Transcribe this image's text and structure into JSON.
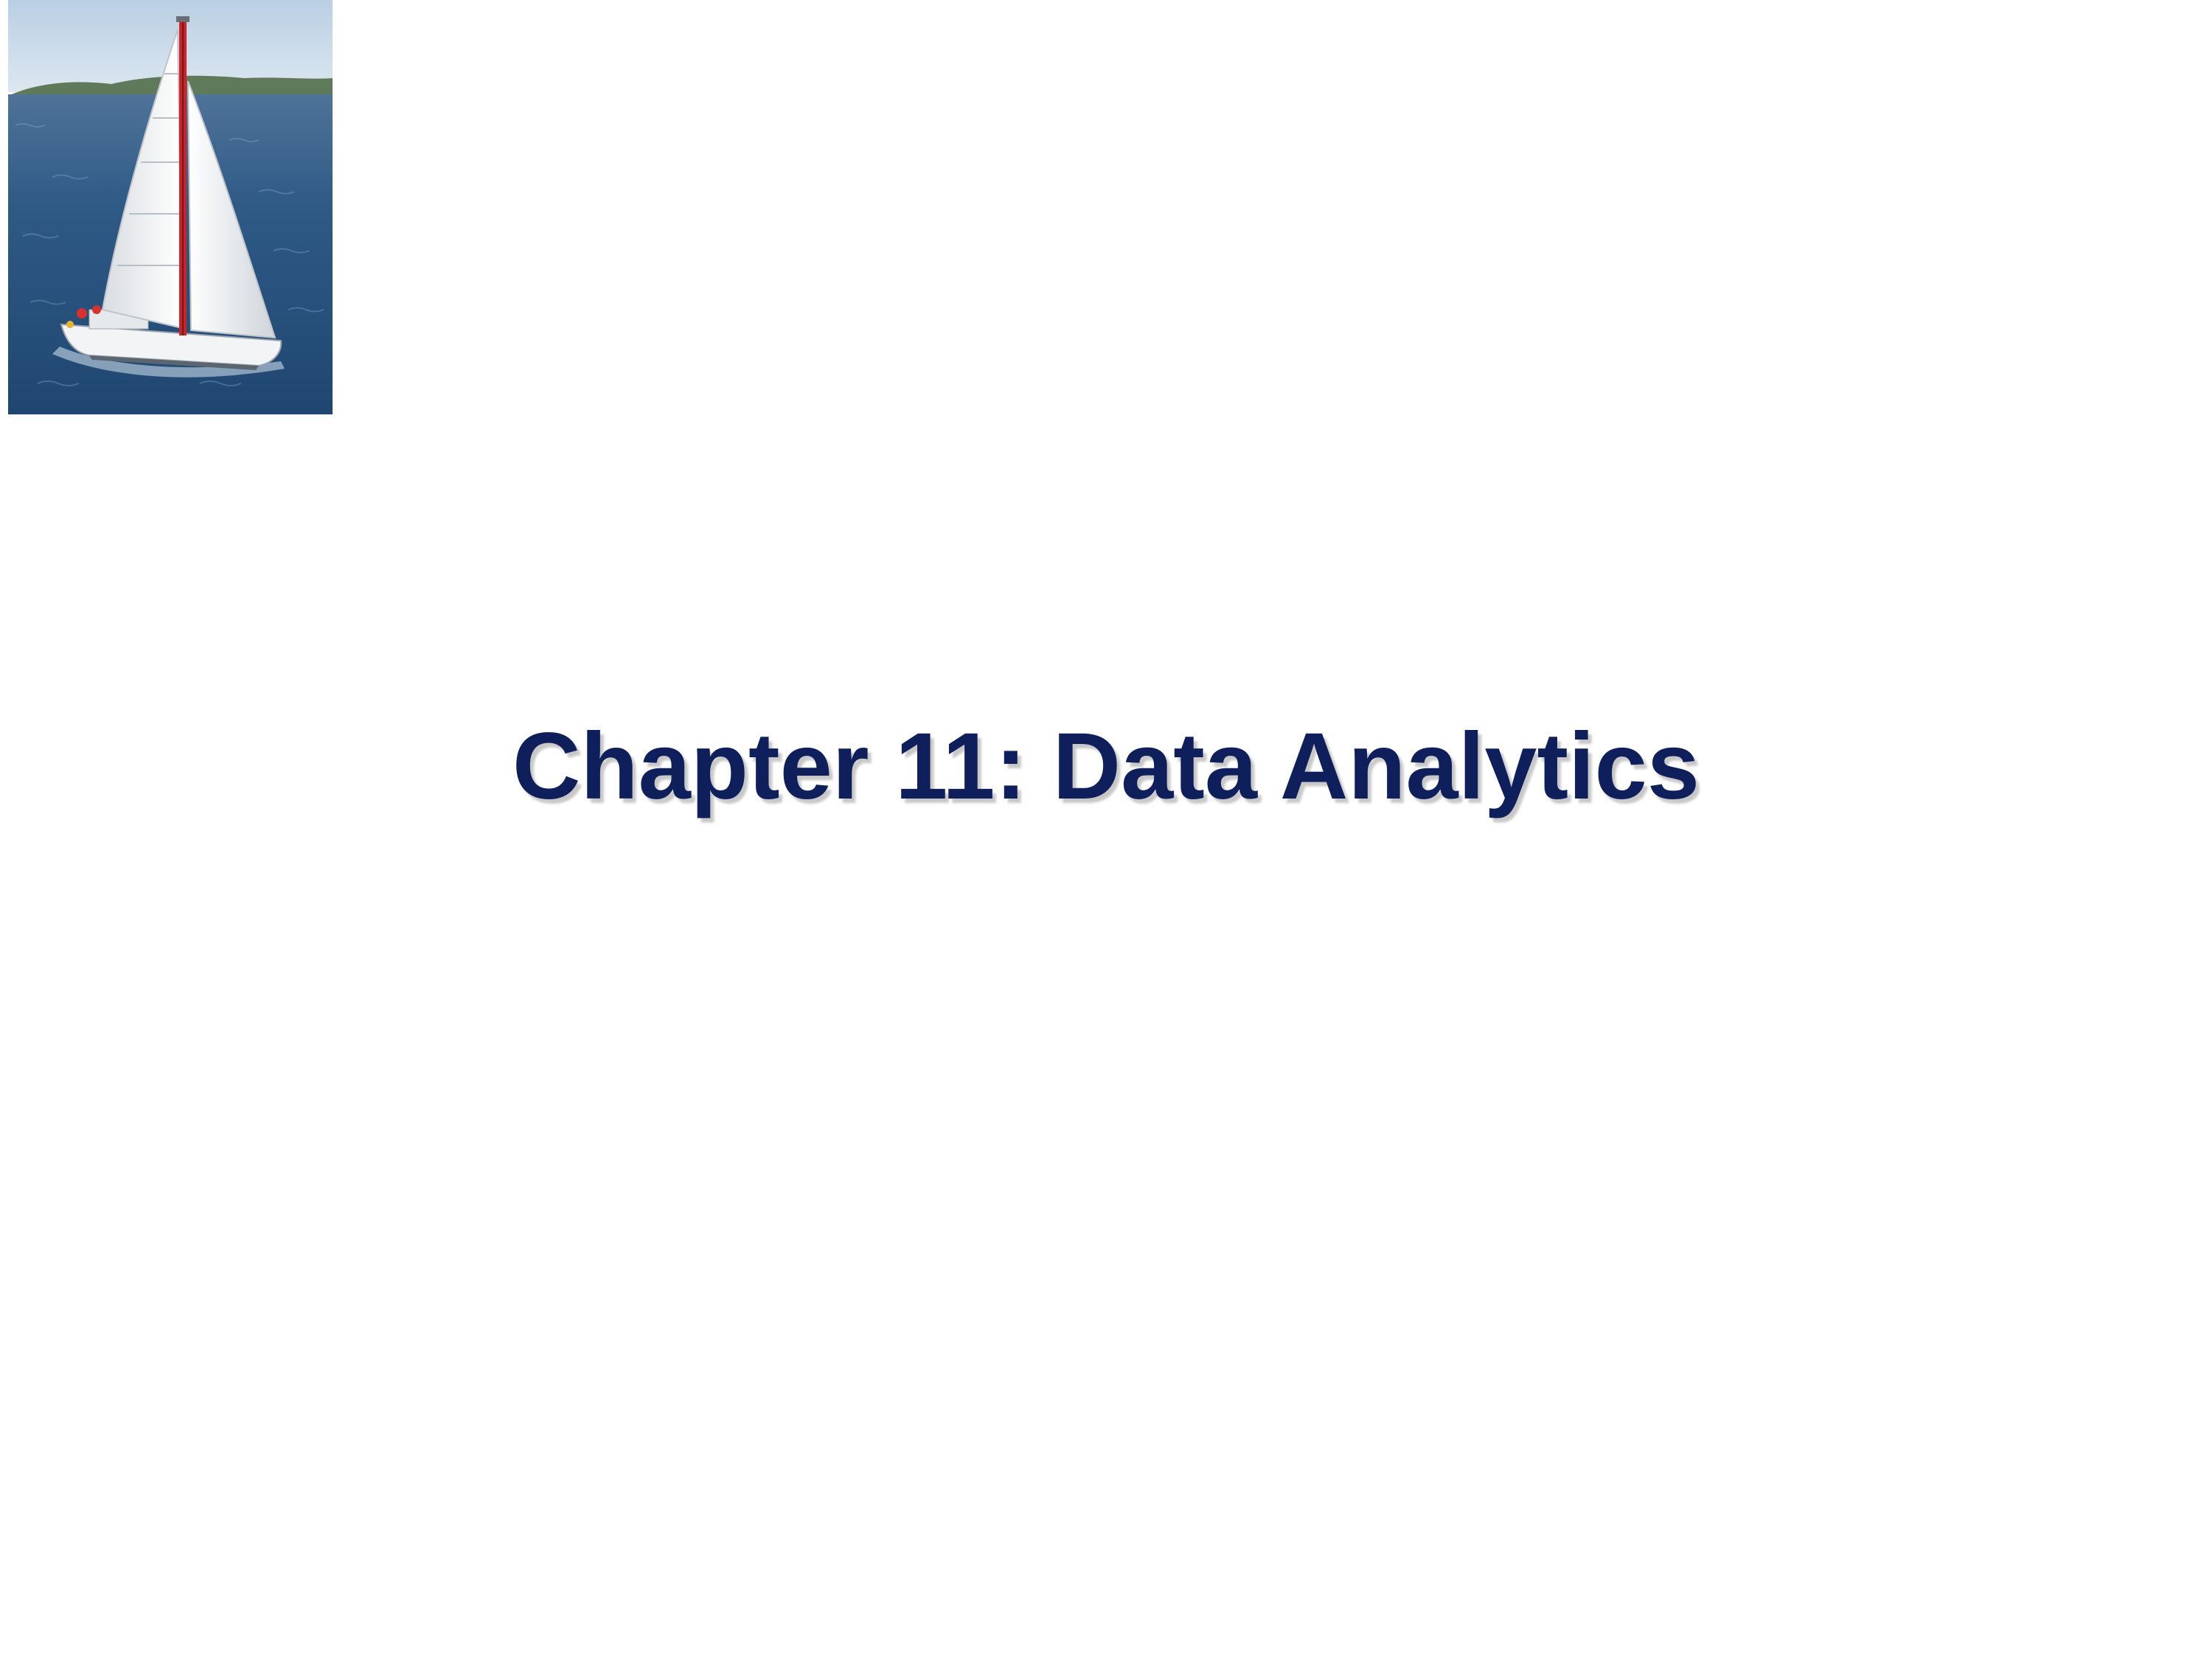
{
  "slide": {
    "title": "Chapter 11: Data Analytics",
    "title_color": "#0e1f5b",
    "image": {
      "icon": "sailboat-photo"
    }
  }
}
